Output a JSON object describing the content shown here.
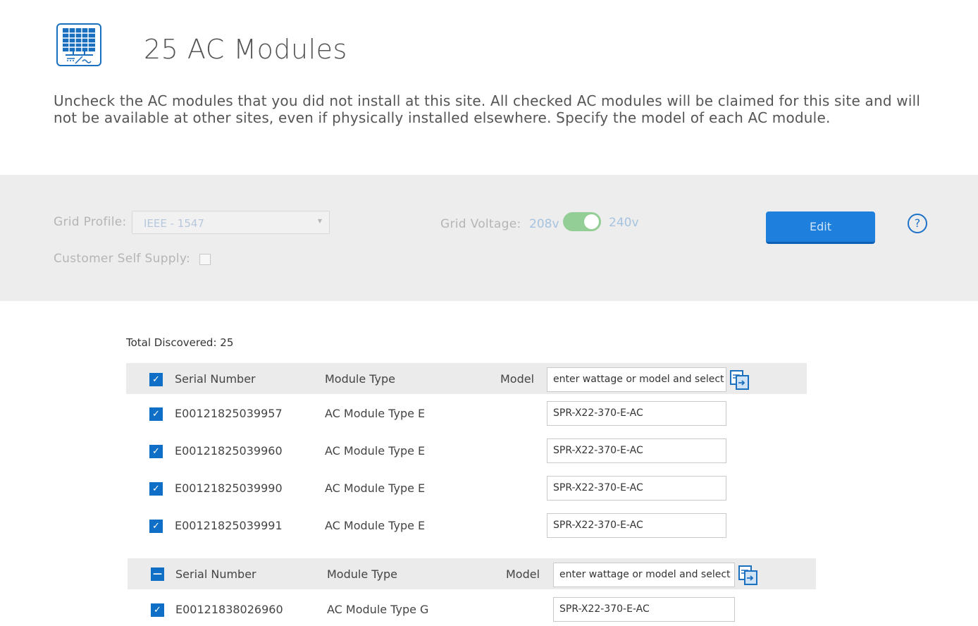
{
  "header": {
    "title": "25 AC Modules",
    "instructions": "Uncheck the AC modules that you did not install at this site. All checked AC modules will be claimed for this site and will not be available at other sites, even if physically installed elsewhere. Specify the model of each AC module."
  },
  "settings": {
    "grid_profile_label": "Grid Profile:",
    "grid_profile_value": "IEEE - 1547",
    "customer_self_supply_label": "Customer Self Supply:",
    "grid_voltage_label": "Grid Voltage:",
    "voltage_low": "208v",
    "voltage_high": "240v",
    "edit_label": "Edit",
    "help_symbol": "?"
  },
  "table": {
    "total_discovered": "Total Discovered: 25",
    "groups": [
      {
        "header": {
          "serial_label": "Serial Number",
          "type_label": "Module Type",
          "model_label": "Model",
          "model_placeholder": "enter wattage or model and select",
          "state": "checked"
        },
        "rows": [
          {
            "serial": "E00121825039957",
            "type": "AC Module Type E",
            "model": "SPR-X22-370-E-AC"
          },
          {
            "serial": "E00121825039960",
            "type": "AC Module Type E",
            "model": "SPR-X22-370-E-AC"
          },
          {
            "serial": "E00121825039990",
            "type": "AC Module Type E",
            "model": "SPR-X22-370-E-AC"
          },
          {
            "serial": "E00121825039991",
            "type": "AC Module Type E",
            "model": "SPR-X22-370-E-AC"
          }
        ]
      },
      {
        "header": {
          "serial_label": "Serial Number",
          "type_label": "Module Type",
          "model_label": "Model",
          "model_placeholder": "enter wattage or model and select",
          "state": "indeterminate"
        },
        "rows": [
          {
            "serial": "E00121838026960",
            "type": "AC Module Type G",
            "model": "SPR-X22-370-E-AC"
          }
        ]
      }
    ]
  },
  "icons": {
    "logo": "solar-panel-icon",
    "copy": "copy-to-all-icon",
    "check": "✓",
    "dash": "—"
  },
  "colors": {
    "accent": "#0f6fc6",
    "edit_button": "#1e7fdc",
    "toggle_on": "#93ce96"
  }
}
